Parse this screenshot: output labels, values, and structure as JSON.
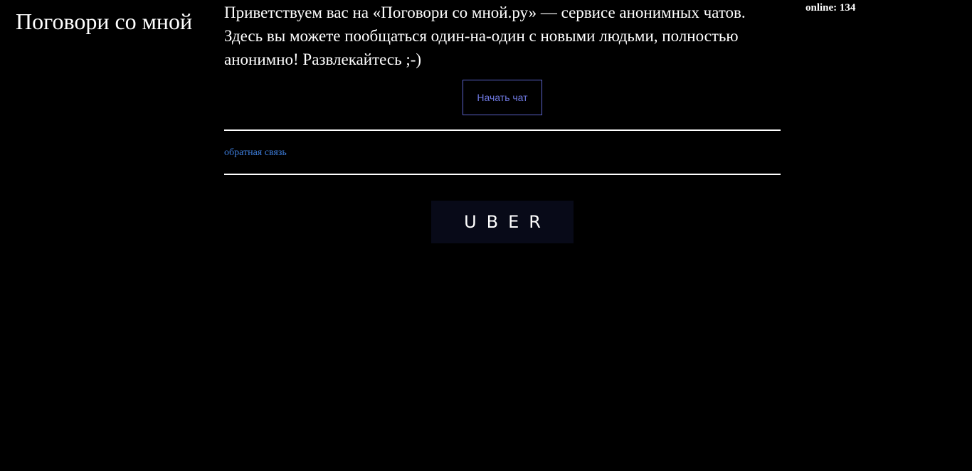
{
  "header": {
    "site_title": "Поговори со мной",
    "online_counter": "online: 134"
  },
  "main": {
    "intro_text": "Приветствуем вас на «Поговори со мной.ру» — сервисе анонимных чатов. Здесь вы можете пообщаться один-на-один с новыми людьми, полностью анонимно! Развлекайтесь ;-)",
    "start_button_label": "Начать чат",
    "feedback_link_label": "обратная связь"
  },
  "ad": {
    "logo_text": "UBER"
  },
  "colors": {
    "background": "#000000",
    "text": "#ffffff",
    "button_border": "#5a62c8",
    "link": "#3d7ddb",
    "ad_background": "#080a18"
  }
}
